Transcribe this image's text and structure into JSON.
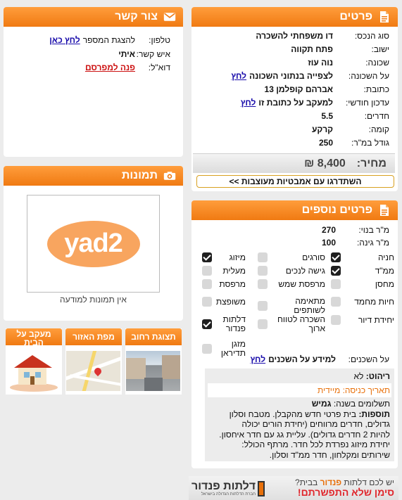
{
  "details": {
    "title": "פרטים",
    "rows": [
      {
        "label": "סוג הנכס:",
        "value": "דו משפחתי להשכרה"
      },
      {
        "label": "ישוב:",
        "value": "פתח תקווה"
      },
      {
        "label": "שכונה:",
        "value": "נוה עוז"
      },
      {
        "label": "על השכונה:",
        "value": "לצפייה בנתוני השכונה",
        "link": "לחץ"
      },
      {
        "label": "כתובת:",
        "value": "אברהם קופלמן 13"
      },
      {
        "label": "עדכון חודשי:",
        "value": "למעקב על כתובת זו",
        "link": "לחץ"
      },
      {
        "label": "חדרים:",
        "value": "5.5"
      },
      {
        "label": "קומה:",
        "value": "קרקע"
      },
      {
        "label": "גודל במ\"ר:",
        "value": "250"
      }
    ],
    "price_label": "מחיר:",
    "price_value": "8,400 ₪",
    "promo": "השתדרגו עם אמבטיות מעוצבות >>"
  },
  "more": {
    "title": "פרטים נוספים",
    "built_label": "מ\"ר בנוי:",
    "built_value": "270",
    "garden_label": "מ\"ר גינה:",
    "garden_value": "100",
    "features": [
      {
        "label": "מיזוג",
        "checked": true
      },
      {
        "label": "סורגים",
        "checked": false
      },
      {
        "label": "חניה",
        "checked": true
      },
      {
        "label": "מעלית",
        "checked": false
      },
      {
        "label": "גישה לנכים",
        "checked": false
      },
      {
        "label": "ממ\"ד",
        "checked": true
      },
      {
        "label": "מרפסת",
        "checked": false
      },
      {
        "label": "מרפסת שמש",
        "checked": false
      },
      {
        "label": "מחסן",
        "checked": false
      },
      {
        "label": "משופצת",
        "checked": false
      },
      {
        "label": "מתאימה לשותפים",
        "checked": false
      },
      {
        "label": "חיות מחמד",
        "checked": false
      },
      {
        "label": "דלתות פנדור",
        "checked": true
      },
      {
        "label": "השכרה לטווח ארוך",
        "checked": false
      },
      {
        "label": "יחידת דיור",
        "checked": false
      },
      {
        "label": "מזגן תדיראן",
        "checked": false
      }
    ],
    "neighbors_label": "על השכנים:",
    "neighbors_value": "למידע על השכנים",
    "neighbors_link": "לחץ",
    "furniture_label": "ריהוט:",
    "furniture_value": "לא",
    "entry_label": "תאריך כניסה:",
    "entry_value": "מיידית",
    "payments_label": "תשלומים בשנה:",
    "payments_value": "גמיש",
    "extra_label": "תוספות:",
    "extra_lines": [
      "בית פרטי חדש מהקבלן. מטבח וסלון",
      "גדולים, חדרים מרווחים (יחידת הורים יכולה",
      "להיות 2 חדרים גדולים). עליית גג עם חדר איחסון.",
      "יחידת מיזוג נפרדת לכל חדר. מרתף הכולל:",
      "שירותים ומקלחון, חדר ממ\"ד וסלון."
    ]
  },
  "contact": {
    "title": "צור קשר",
    "phone_label": "טלפון:",
    "phone_text": "להצגת המספר",
    "phone_link": "לחץ כאן",
    "person_label": "איש קשר:",
    "person_value": "איתי",
    "email_label": "דוא\"ל:",
    "email_link": "פנה למפרסם"
  },
  "photos": {
    "title": "תמונות",
    "logo_text": "yad2",
    "no_photos": "אין תמונות למודעה"
  },
  "tabs": {
    "street": "תצוגת רחוב",
    "map": "מפת האזור",
    "track": "מעקב על הבית"
  },
  "banner": {
    "line1_a": "יש לכם דלתות",
    "line1_b": "פנדור",
    "line1_c": "בבית?",
    "line2": "סימן שלא התפשרתם!",
    "brand": "דלתות פנדור",
    "brand_sub": "חברת הדלתות הגדולה בישראל"
  },
  "colors": {
    "accent": "#f07a12",
    "link": "#1a0dab",
    "price_bg": "#e6e6e6"
  }
}
